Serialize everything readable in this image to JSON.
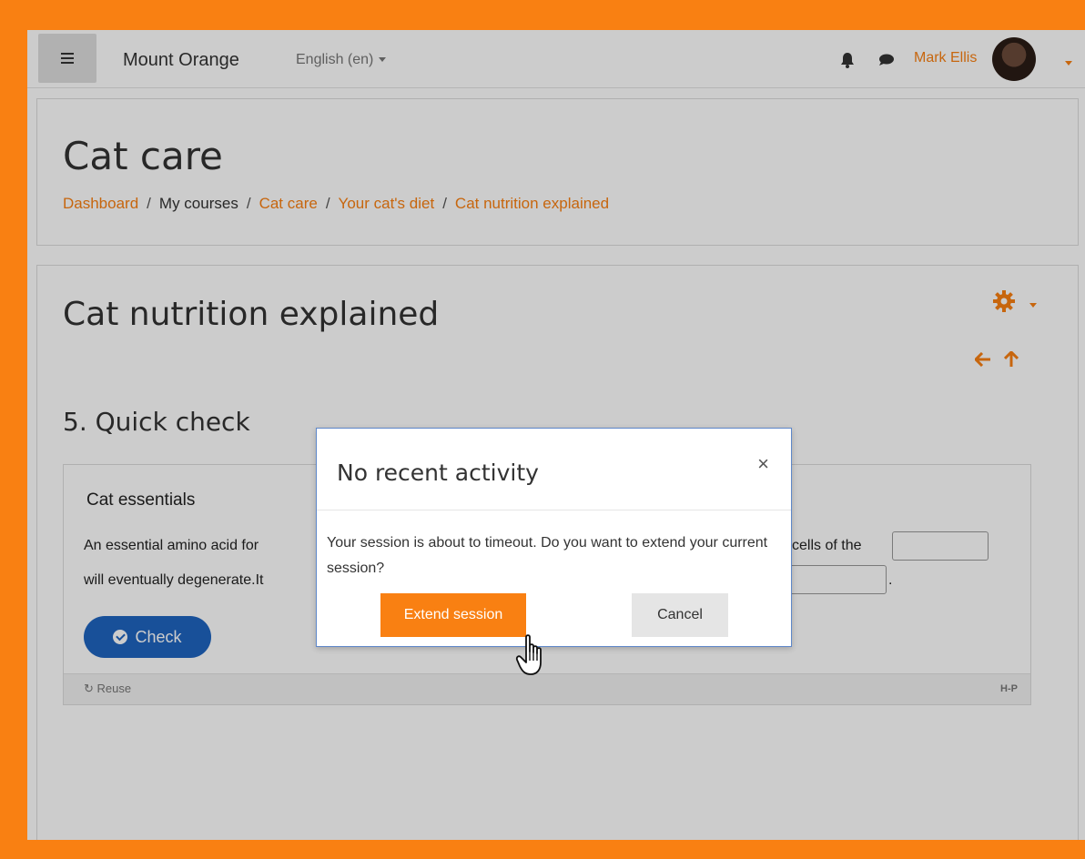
{
  "navbar": {
    "site_name": "Mount Orange",
    "language": "English (en)",
    "user_name": "Mark Ellis"
  },
  "header": {
    "course_title": "Cat care",
    "breadcrumb": [
      "Dashboard",
      "My courses",
      "Cat care",
      "Your cat's diet",
      "Cat nutrition explained"
    ],
    "breadcrumb_sep": "/"
  },
  "main": {
    "page_title": "Cat nutrition explained",
    "section_title": "5. Quick check",
    "h5p": {
      "title": "Cat essentials",
      "text_line1": "An essential amino acid for",
      "text_line2": "will eventually degenerate.It",
      "text_after": "cells of the",
      "blank_dot": ".",
      "check_label": "Check",
      "reuse_label": "Reuse",
      "logo": "H-P"
    }
  },
  "modal": {
    "title": "No recent activity",
    "close": "×",
    "body": "Your session is about to timeout. Do you want to extend your current session?",
    "extend_label": "Extend session",
    "cancel_label": "Cancel"
  },
  "colors": {
    "brand_orange": "#f98012",
    "check_blue": "#1f64c0",
    "modal_border": "#5e87c9"
  },
  "icons": [
    "menu-icon",
    "bell-icon",
    "chat-icon",
    "gear-icon",
    "arrow-left-icon",
    "arrow-up-icon",
    "check-circle-icon",
    "reuse-icon",
    "close-icon",
    "hand-cursor-icon"
  ]
}
